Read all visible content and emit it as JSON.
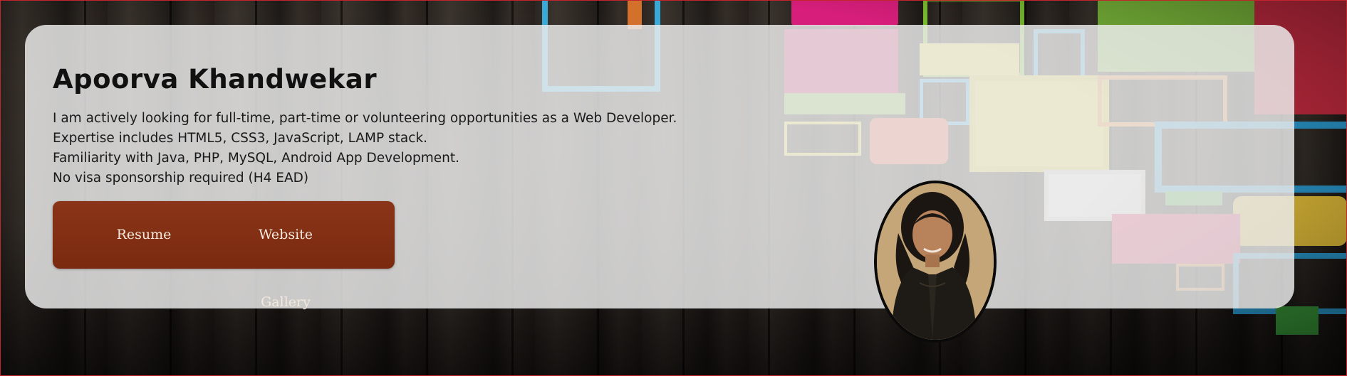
{
  "profile": {
    "name": "Apoorva Khandwekar",
    "lines": [
      "I am actively looking for full-time, part-time or volunteering opportunities as a Web Developer.",
      "Expertise includes HTML5, CSS3, JavaScript, LAMP stack.",
      "Familiarity with Java, PHP, MySQL, Android App Development.",
      "No visa sponsorship required (H4 EAD)"
    ]
  },
  "nav": {
    "resume_label": "Resume",
    "gallery_label": "Website Gallery"
  },
  "colors": {
    "button_bar": "#7e2d12",
    "frame_border": "#c0262b",
    "card": "#ececec"
  }
}
